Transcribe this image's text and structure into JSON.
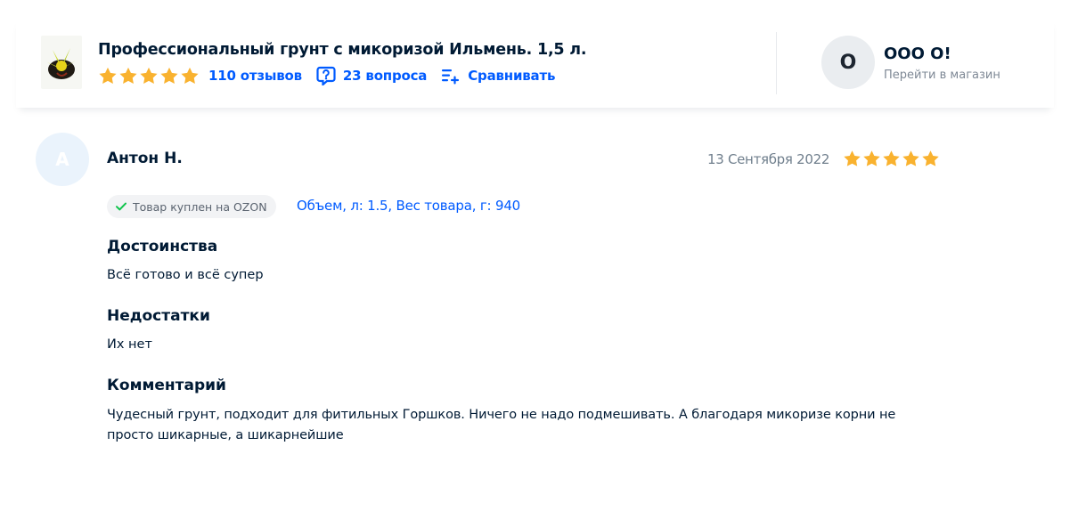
{
  "product": {
    "title": "Профессиональный грунт с микоризой Ильмень. 1,5 л.",
    "rating_stars": 5,
    "reviews_link": "110 отзывов",
    "questions_link": "23 вопроса",
    "compare_link": "Сравнивать",
    "icons": {
      "questions": "question-bubble-icon",
      "compare": "compare-list-icon",
      "thumb": "product-image"
    }
  },
  "shop": {
    "avatar_letter": "О",
    "name": "ООО О!",
    "link": "Перейти в магазин"
  },
  "review": {
    "avatar_letter": "А",
    "author": "Антон Н.",
    "date": "13 Сентября 2022",
    "rating_stars": 5,
    "badge": "Товар куплен на OZON",
    "variant": "Объем, л: 1.5, Вес товара, г: 940",
    "pros_title": "Достоинства",
    "pros_text": "Всё готово и всё супер",
    "cons_title": "Недостатки",
    "cons_text": "Их нет",
    "comment_title": "Комментарий",
    "comment_text": "Чудесный грунт, подходит для фитильных Горшков. Ничего не надо подмешивать. А благодаря микоризе корни не просто шикарные, а шикарнейшие"
  },
  "colors": {
    "star": "#f9b22f",
    "link": "#005bff",
    "text": "#001a34",
    "check": "#10c44c"
  }
}
